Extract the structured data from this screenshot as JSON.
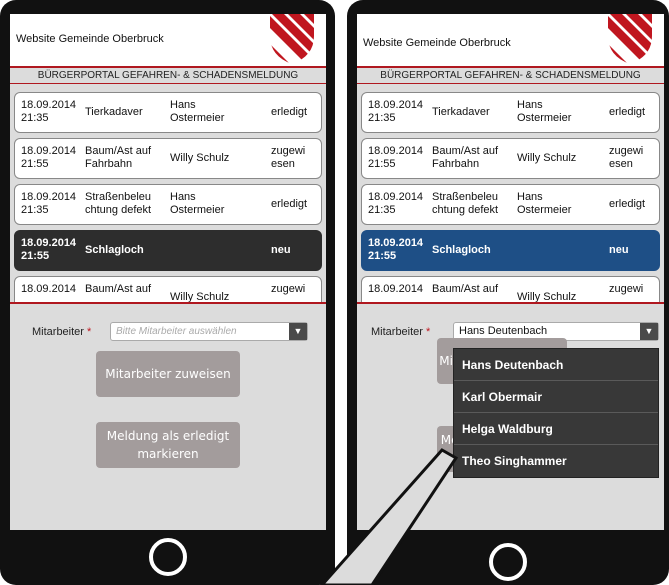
{
  "site_title": "Website Gemeinde Oberbruck",
  "portal_title": "BÜRGERPORTAL GEFAHREN- & SCHADENSMELDUNG",
  "reports": [
    {
      "date": "18.09.2014",
      "time": "21:35",
      "type_l1": "Tierkadaver",
      "type_l2": "",
      "person_l1": "Hans",
      "person_l2": "Ostermeier",
      "status_l1": "erledigt",
      "status_l2": ""
    },
    {
      "date": "18.09.2014",
      "time": "21:55",
      "type_l1": "Baum/Ast auf",
      "type_l2": "Fahrbahn",
      "person_l1": "Willy Schulz",
      "person_l2": "",
      "status_l1": "zugewi",
      "status_l2": "esen"
    },
    {
      "date": "18.09.2014",
      "time": "21:35",
      "type_l1": "Straßenbeleu",
      "type_l2": "chtung defekt",
      "person_l1": "Hans",
      "person_l2": "Ostermeier",
      "status_l1": "erledigt",
      "status_l2": ""
    },
    {
      "date": "18.09.2014",
      "time": "21:55",
      "type_l1": "Schlagloch",
      "type_l2": "",
      "person_l1": "",
      "person_l2": "",
      "status_l1": "neu",
      "status_l2": ""
    },
    {
      "date": "18.09.2014",
      "time": "",
      "type_l1": "Baum/Ast auf",
      "type_l2": "",
      "person_l1": "Willy Schulz",
      "person_l2": "",
      "status_l1": "zugewi",
      "status_l2": ""
    }
  ],
  "form": {
    "label": "Mitarbeiter",
    "required_mark": "*",
    "placeholder": "Bitte Mitarbeiter auswählen",
    "selected_value": "Hans Deutenbach",
    "assign_button": "Mitarbeiter zuweisen",
    "done_button_l1": "Meldung als erledigt",
    "done_button_l2": "markieren"
  },
  "dropdown_options": [
    "Hans Deutenbach",
    "Karl Obermair",
    "Helga Waldburg",
    "Theo Singhammer"
  ],
  "colors": {
    "accent_red": "#b01820",
    "selected_row_dark": "#2d2d2d",
    "selected_row_blue": "#1e4f86",
    "button_gray": "#a39c9c"
  },
  "icons": {
    "crest": "red-white-striped-shield-icon",
    "select_arrow": "chevron-down-icon",
    "home_button": "home-button-icon"
  }
}
